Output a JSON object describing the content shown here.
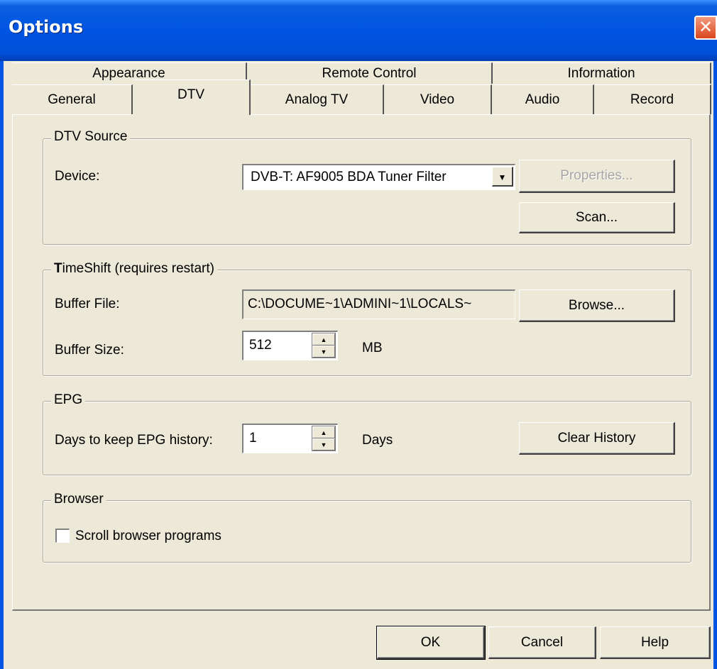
{
  "window": {
    "title": "Options",
    "close_glyph": "✕"
  },
  "tabs": {
    "row1": [
      "Appearance",
      "Remote Control",
      "Information"
    ],
    "row2": [
      "General",
      "DTV",
      "Analog TV",
      "Video",
      "Audio",
      "Record"
    ],
    "active": "DTV"
  },
  "dtv_source": {
    "title": "DTV Source",
    "device_label": "Device:",
    "device_value": "DVB-T: AF9005 BDA Tuner Filter",
    "properties_label": "Properties...",
    "scan_label": "Scan..."
  },
  "timeshift": {
    "title_bold": "T",
    "title_rest": "imeShift (requires restart)",
    "buffer_file_label": "Buffer File:",
    "buffer_file_value": "C:\\DOCUME~1\\ADMINI~1\\LOCALS~",
    "browse_label": "Browse...",
    "buffer_size_label": "Buffer Size:",
    "buffer_size_value": "512",
    "unit": "MB"
  },
  "epg": {
    "title": "EPG",
    "days_label": "Days to keep EPG history:",
    "days_value": "1",
    "days_unit": "Days",
    "clear_label": "Clear History"
  },
  "browser": {
    "title": "Browser",
    "scroll_label": "Scroll browser programs",
    "scroll_checked": false
  },
  "footer": {
    "ok": "OK",
    "cancel": "Cancel",
    "help": "Help"
  },
  "icons": {
    "up": "▲",
    "down": "▼"
  }
}
